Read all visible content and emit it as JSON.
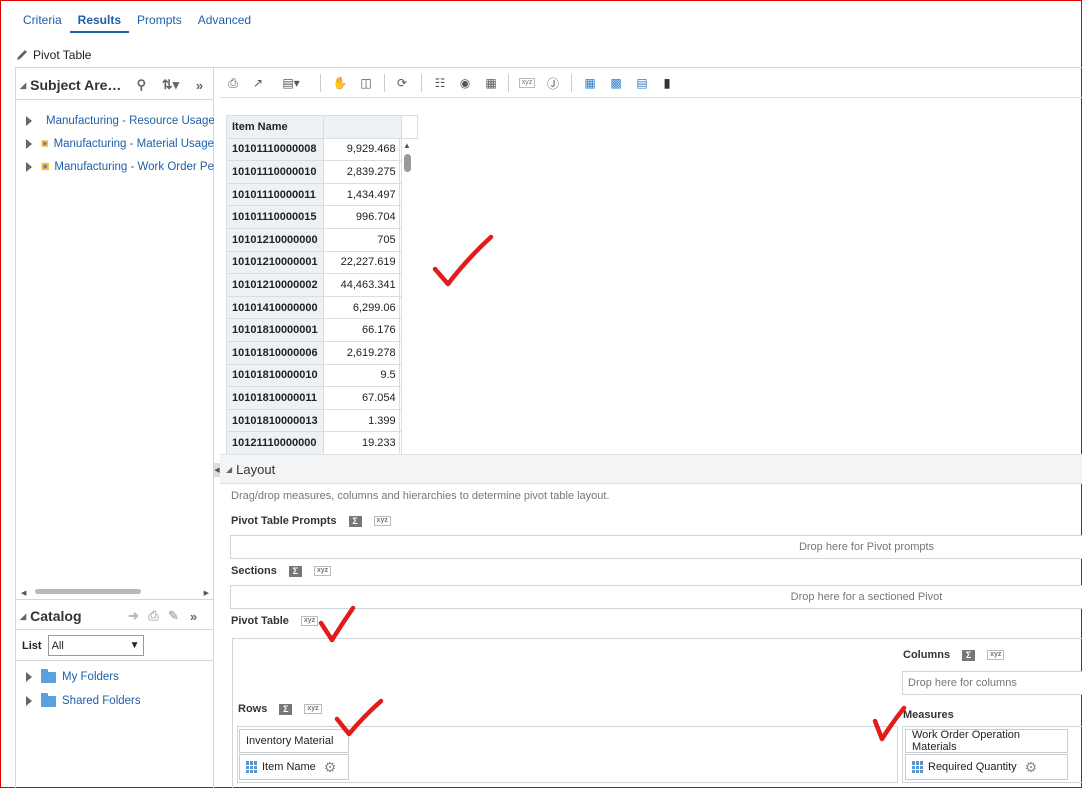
{
  "tabs": [
    "Criteria",
    "Results",
    "Prompts",
    "Advanced"
  ],
  "view_title": "Pivot Table",
  "subject_areas": {
    "title": "Subject Are…",
    "items": [
      "Manufacturing - Resource Usage",
      "Manufacturing - Material Usage",
      "Manufacturing - Work Order Pe"
    ]
  },
  "catalog": {
    "title": "Catalog",
    "list_label": "List",
    "list_value": "All",
    "folders": [
      "My Folders",
      "Shared Folders"
    ]
  },
  "pivot": {
    "header": "Item Name",
    "rows": [
      {
        "item": "10101110000008",
        "value": "9,929.468"
      },
      {
        "item": "10101110000010",
        "value": "2,839.275"
      },
      {
        "item": "10101110000011",
        "value": "1,434.497"
      },
      {
        "item": "10101110000015",
        "value": "996.704"
      },
      {
        "item": "10101210000000",
        "value": "705"
      },
      {
        "item": "10101210000001",
        "value": "22,227.619"
      },
      {
        "item": "10101210000002",
        "value": "44,463.341"
      },
      {
        "item": "10101410000000",
        "value": "6,299.06"
      },
      {
        "item": "10101810000001",
        "value": "66.176"
      },
      {
        "item": "10101810000006",
        "value": "2,619.278"
      },
      {
        "item": "10101810000010",
        "value": "9.5"
      },
      {
        "item": "10101810000011",
        "value": "67.054"
      },
      {
        "item": "10101810000013",
        "value": "1.399"
      },
      {
        "item": "10121110000000",
        "value": "19.233"
      }
    ]
  },
  "layout": {
    "title": "Layout",
    "description": "Drag/drop measures, columns and hierarchies to determine pivot table layout.",
    "pivot_prompts_label": "Pivot Table Prompts",
    "pivot_prompts_drop": "Drop here for Pivot prompts",
    "sections_label": "Sections",
    "sections_drop": "Drop here for a sectioned Pivot",
    "pivot_table_label": "Pivot Table",
    "columns_label": "Columns",
    "columns_drop": "Drop here for columns",
    "rows_label": "Rows",
    "rows_group": "Inventory Material",
    "rows_item": "Item Name",
    "measures_label": "Measures",
    "measures_group": "Work Order Operation Materials",
    "measures_item": "Required Quantity"
  },
  "icons": {
    "sigma": "Σ",
    "xyz": "xyz",
    "gear": "⚙",
    "search": "⚲"
  },
  "annotation_color": "#e31b1b"
}
